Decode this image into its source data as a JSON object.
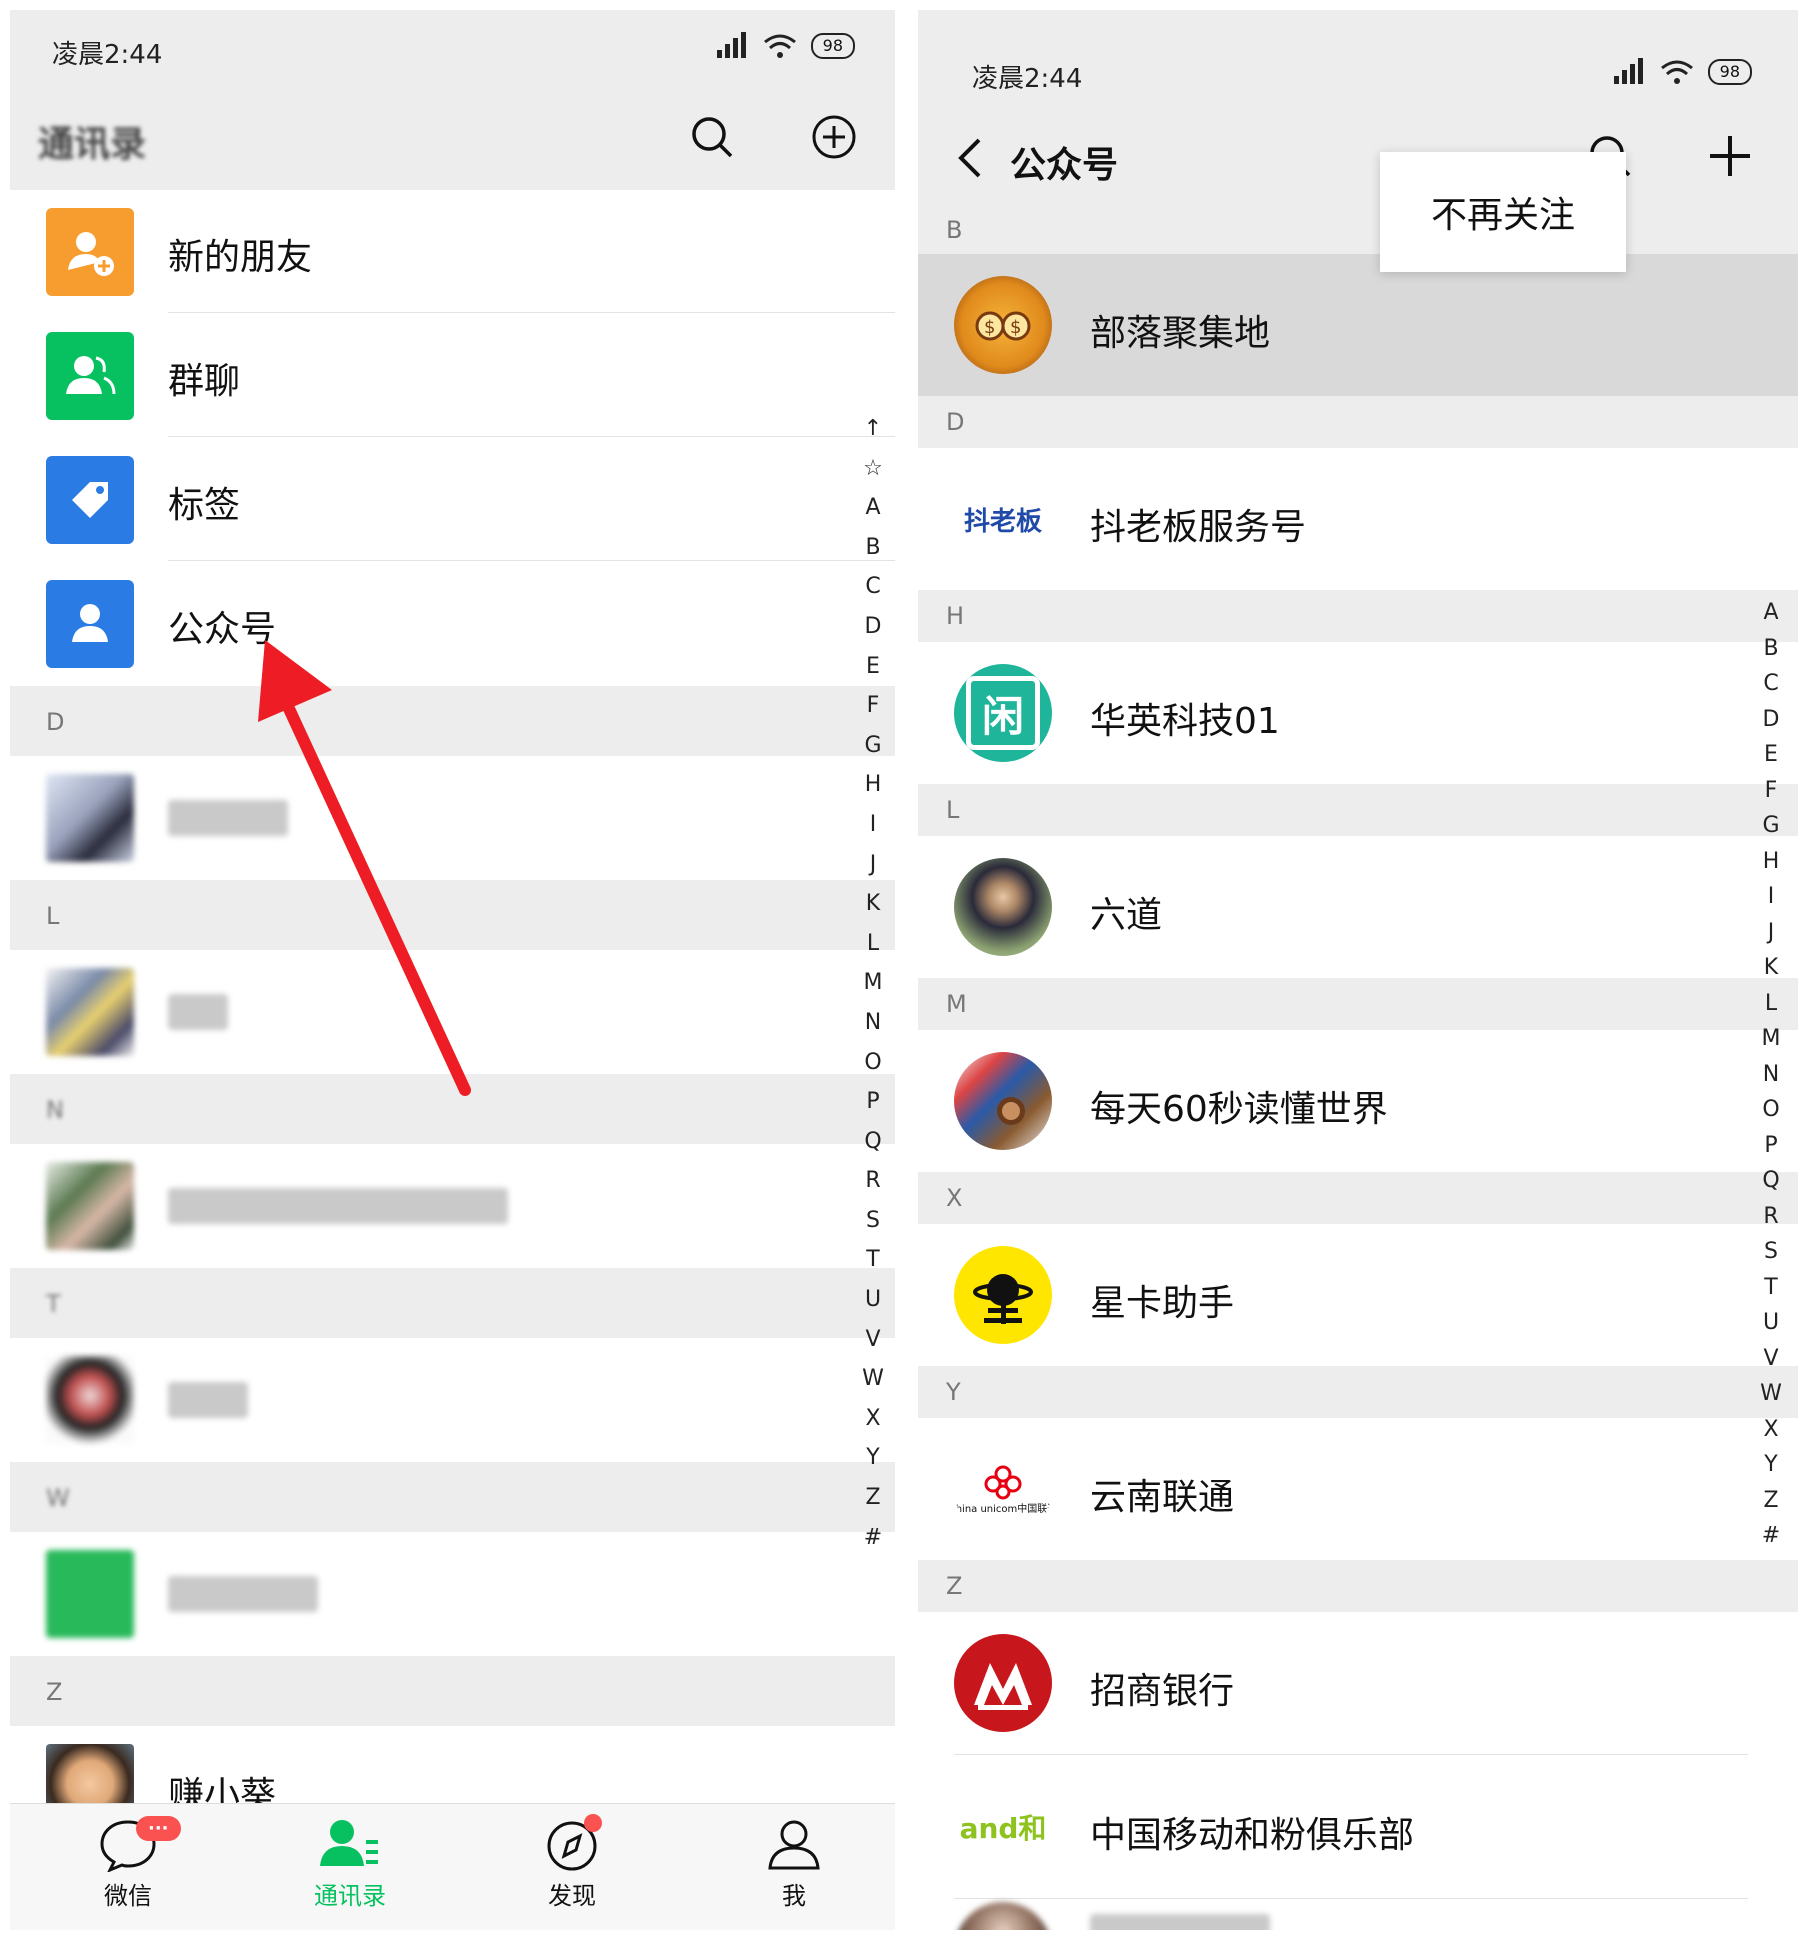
{
  "left": {
    "status_time": "凌晨2:44",
    "battery": "98",
    "title": "通讯录",
    "menu_items": [
      {
        "label": "新的朋友",
        "color": "#f79c2f",
        "icon": "add-friend-icon"
      },
      {
        "label": "群聊",
        "color": "#07c160",
        "icon": "group-chat-icon"
      },
      {
        "label": "标签",
        "color": "#2b7be4",
        "icon": "tag-icon"
      },
      {
        "label": "公众号",
        "color": "#2b7be4",
        "icon": "official-account-icon"
      }
    ],
    "sections": {
      "d": "D",
      "l": "L",
      "n": "N",
      "t": "T",
      "w": "W",
      "z": "Z"
    },
    "last_contact": "赚小葵",
    "index_letters": [
      "↑",
      "☆",
      "A",
      "B",
      "C",
      "D",
      "E",
      "F",
      "G",
      "H",
      "I",
      "J",
      "K",
      "L",
      "M",
      "N",
      "O",
      "P",
      "Q",
      "R",
      "S",
      "T",
      "U",
      "V",
      "W",
      "X",
      "Y",
      "Z",
      "#"
    ],
    "tabs": [
      {
        "label": "微信",
        "icon": "chat-icon"
      },
      {
        "label": "通讯录",
        "icon": "contacts-icon"
      },
      {
        "label": "发现",
        "icon": "compass-icon"
      },
      {
        "label": "我",
        "icon": "person-icon"
      }
    ],
    "badge": "···",
    "annotation_color": "#ee1c24"
  },
  "right": {
    "status_time": "凌晨2:44",
    "battery": "98",
    "title": "公众号",
    "popup": "不再关注",
    "sections": {
      "b": "B",
      "d": "D",
      "h": "H",
      "l": "L",
      "m": "M",
      "x": "X",
      "y": "Y",
      "z": "Z"
    },
    "accounts": [
      {
        "name": "部落聚集地"
      },
      {
        "name": "抖老板服务号",
        "logo": "抖老板"
      },
      {
        "name": "华英科技01",
        "logo": "闲"
      },
      {
        "name": "六道"
      },
      {
        "name": "每天60秒读懂世界"
      },
      {
        "name": "星卡助手"
      },
      {
        "name": "云南联通",
        "logo": "China unicom中国联通"
      },
      {
        "name": "招商银行"
      },
      {
        "name": "中国移动和粉俱乐部",
        "logo": "and和"
      }
    ],
    "index_letters": [
      "A",
      "B",
      "C",
      "D",
      "E",
      "F",
      "G",
      "H",
      "I",
      "J",
      "K",
      "L",
      "M",
      "N",
      "O",
      "P",
      "Q",
      "R",
      "S",
      "T",
      "U",
      "V",
      "W",
      "X",
      "Y",
      "Z",
      "#"
    ]
  }
}
